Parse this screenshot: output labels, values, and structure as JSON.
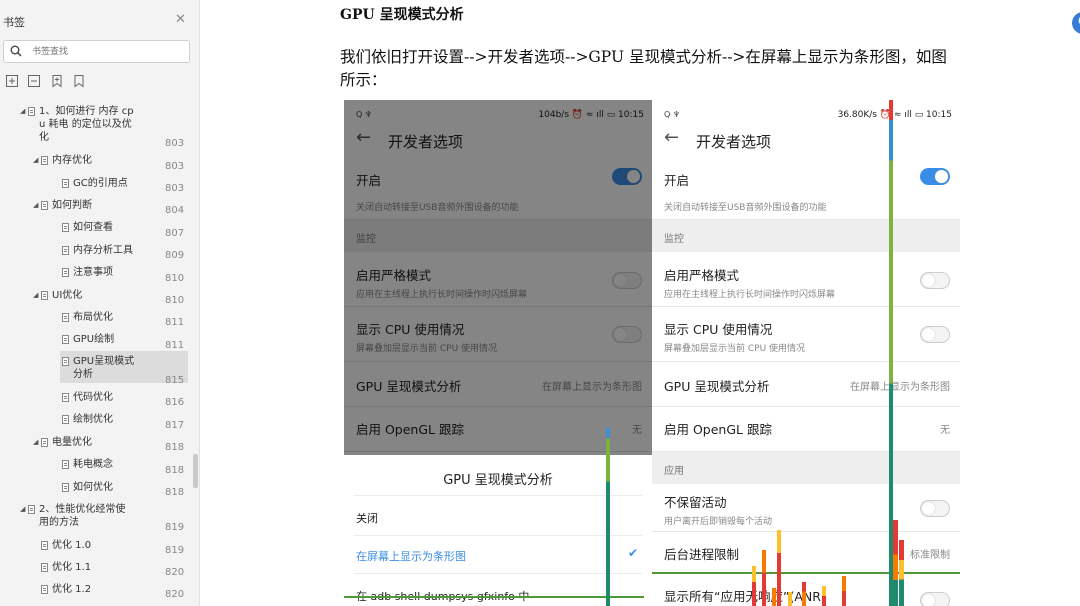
{
  "sidebar": {
    "title": "书签",
    "search_placeholder": "书签查找",
    "toc": [
      {
        "label": "1、如何进行 内存 cp\nu 耗电 的定位以及优\n化",
        "page": "803",
        "level": 1,
        "arrow": true
      },
      {
        "label": "内存优化",
        "page": "803",
        "level": 2,
        "arrow": true
      },
      {
        "label": "GC的引用点",
        "page": "803",
        "level": 3,
        "arrow": false
      },
      {
        "label": "如何判断",
        "page": "804",
        "level": 2,
        "arrow": true
      },
      {
        "label": "如何查看",
        "page": "807",
        "level": 3,
        "arrow": false
      },
      {
        "label": "内存分析工具",
        "page": "809",
        "level": 3,
        "arrow": false
      },
      {
        "label": "注意事项",
        "page": "810",
        "level": 3,
        "arrow": false
      },
      {
        "label": "UI优化",
        "page": "810",
        "level": 2,
        "arrow": true
      },
      {
        "label": "布局优化",
        "page": "811",
        "level": 3,
        "arrow": false
      },
      {
        "label": "GPU绘制",
        "page": "811",
        "level": 3,
        "arrow": false
      },
      {
        "label": "GPU呈现模式\n分析",
        "page": "815",
        "level": 3,
        "arrow": false,
        "selected": true
      },
      {
        "label": "代码优化",
        "page": "816",
        "level": 3,
        "arrow": false
      },
      {
        "label": "绘制优化",
        "page": "817",
        "level": 3,
        "arrow": false
      },
      {
        "label": "电量优化",
        "page": "818",
        "level": 2,
        "arrow": true
      },
      {
        "label": "耗电概念",
        "page": "818",
        "level": 3,
        "arrow": false
      },
      {
        "label": "如何优化",
        "page": "818",
        "level": 3,
        "arrow": false
      },
      {
        "label": "2、性能优化经常使\n用的方法",
        "page": "819",
        "level": 1,
        "arrow": true
      },
      {
        "label": "优化 1.0",
        "page": "819",
        "level": 2,
        "arrow": false
      },
      {
        "label": "优化 1.1",
        "page": "820",
        "level": 2,
        "arrow": false
      },
      {
        "label": "优化 1.2",
        "page": "820",
        "level": 2,
        "arrow": false
      }
    ]
  },
  "main": {
    "heading": "GPU 呈现模式分析",
    "paragraph": "我们依旧打开设置-->开发者选项-->GPU 呈现模式分析-->在屏幕上显示为条形图，如图所示：",
    "float_button": "G"
  },
  "phone_left": {
    "status_left": "Q ♆",
    "status_right": "104b/s ⏰ ≈ ıll ▭ 10:15",
    "title": "开发者选项",
    "enable_label": "开启",
    "usb_note": "关闭自动转接至USB音频外围设备的功能",
    "monitor_section": "监控",
    "strict_label": "启用严格模式",
    "strict_sub": "应用在主线程上执行长时间操作时闪烁屏幕",
    "cpu_label": "显示 CPU 使用情况",
    "cpu_sub": "屏幕叠加层显示当前 CPU 使用情况",
    "gpu_label": "GPU 呈现模式分析",
    "gpu_value": "在屏幕上显示为条形图",
    "opengl_label": "启用 OpenGL 跟踪",
    "opengl_value": "无",
    "dialog_title": "GPU 呈现模式分析",
    "dialog_options": [
      "关闭",
      "在屏幕上显示为条形图",
      "在 adb shell dumpsys gfxinfo 中"
    ]
  },
  "phone_right": {
    "status_left": "Q ♆",
    "status_right": "36.80K/s ⏰ ≈ ıll ▭ 10:15",
    "title": "开发者选项",
    "enable_label": "开启",
    "usb_note": "关闭自动转接至USB音频外围设备的功能",
    "monitor_section": "监控",
    "strict_label": "启用严格模式",
    "strict_sub": "应用在主线程上执行长时间操作时闪烁屏幕",
    "cpu_label": "显示 CPU 使用情况",
    "cpu_sub": "屏幕叠加层显示当前 CPU 使用情况",
    "gpu_label": "GPU 呈现模式分析",
    "gpu_value": "在屏幕上显示为条形图",
    "opengl_label": "启用 OpenGL 跟踪",
    "opengl_value": "无",
    "apps_section": "应用",
    "nokeep_label": "不保留活动",
    "nokeep_sub": "用户离开后即销毁每个活动",
    "bgproc_label": "后台进程限制",
    "bgproc_value": "标准限制",
    "anr_label": "显示所有“应用无响应”(ANR)"
  },
  "colors": {
    "accent": "#3a8de6",
    "bar_blue": "#3b8fd0",
    "bar_green": "#7cb342",
    "bar_teal": "#1f8a70",
    "bar_red": "#e53935",
    "bar_orange": "#f57c00",
    "bar_yellow": "#fbc02d"
  }
}
